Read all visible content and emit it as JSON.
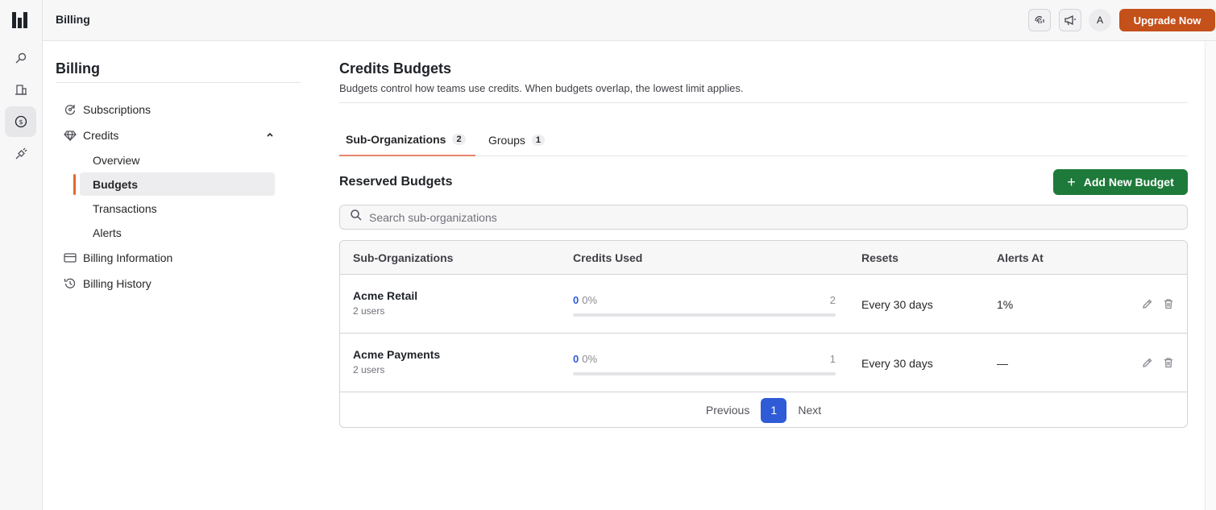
{
  "topbar": {
    "title": "Billing",
    "upgrade_label": "Upgrade Now",
    "avatar_initial": "A"
  },
  "sidebar": {
    "heading": "Billing",
    "items": [
      {
        "label": "Subscriptions",
        "icon": "subscriptions-icon"
      },
      {
        "label": "Credits",
        "icon": "diamond-icon",
        "expanded": true
      },
      {
        "label": "Billing Information",
        "icon": "credit-card-icon"
      },
      {
        "label": "Billing History",
        "icon": "history-icon"
      }
    ],
    "credits_subitems": [
      {
        "label": "Overview"
      },
      {
        "label": "Budgets",
        "active": true
      },
      {
        "label": "Transactions"
      },
      {
        "label": "Alerts"
      }
    ]
  },
  "main": {
    "title": "Credits Budgets",
    "description": "Budgets control how teams use credits. When budgets overlap, the lowest limit applies.",
    "tabs": [
      {
        "label": "Sub-Organizations",
        "count": "2",
        "active": true
      },
      {
        "label": "Groups",
        "count": "1"
      }
    ],
    "section_title": "Reserved Budgets",
    "add_button_label": "Add New Budget",
    "search_placeholder": "Search sub-organizations",
    "table": {
      "columns": [
        "Sub-Organizations",
        "Credits Used",
        "Resets",
        "Alerts At"
      ],
      "rows": [
        {
          "name": "Acme Retail",
          "users": "2 users",
          "used": "0",
          "percent": "0%",
          "max": "2",
          "progress": 0,
          "resets": "Every 30 days",
          "alerts_at": "1%"
        },
        {
          "name": "Acme Payments",
          "users": "2 users",
          "used": "0",
          "percent": "0%",
          "max": "1",
          "progress": 0,
          "resets": "Every 30 days",
          "alerts_at": "—"
        }
      ]
    },
    "pagination": {
      "previous": "Previous",
      "current_page": "1",
      "next": "Next"
    }
  },
  "colors": {
    "accent": "#c4501a",
    "primary_blue": "#2f5bd6",
    "success_green": "#1e7a3a",
    "active_tab_underline": "#e8836e",
    "active_nav_bar": "#e0692f"
  }
}
